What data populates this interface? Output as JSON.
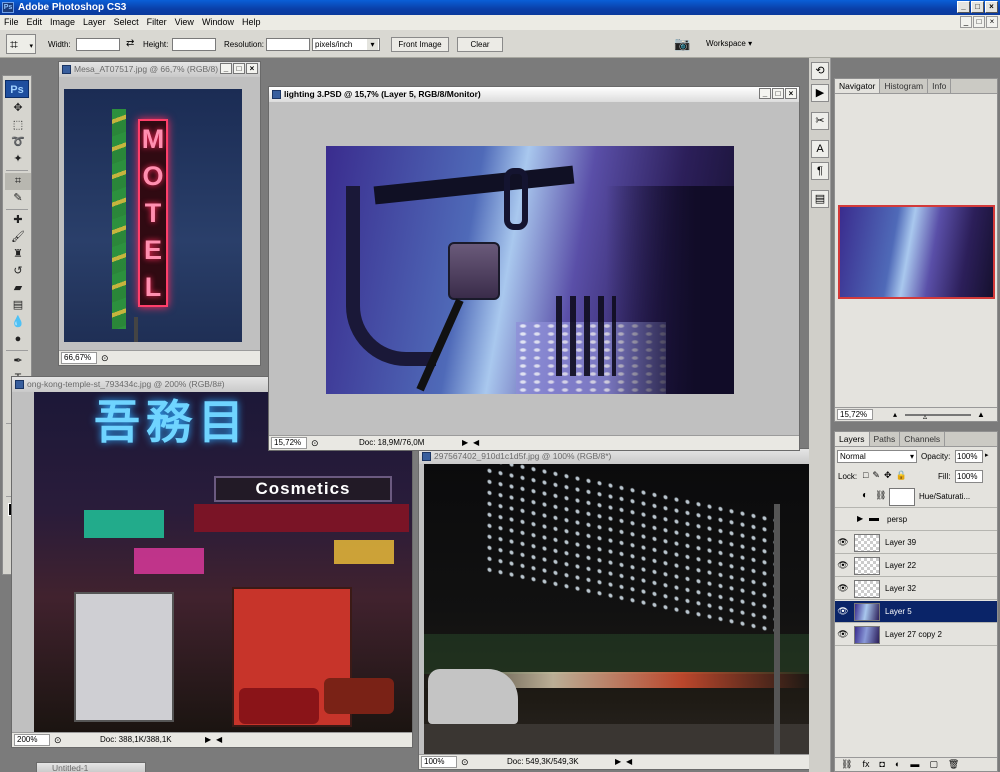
{
  "app": {
    "title": "Adobe Photoshop CS3",
    "logo": "Ps",
    "window_buttons": [
      "_",
      "□",
      "×"
    ]
  },
  "menu": {
    "items": [
      "File",
      "Edit",
      "Image",
      "Layer",
      "Select",
      "Filter",
      "View",
      "Window",
      "Help"
    ],
    "mdi_buttons": [
      "_",
      "□",
      "×"
    ]
  },
  "options": {
    "width_label": "Width:",
    "height_label": "Height:",
    "resolution_label": "Resolution:",
    "units_value": "pixels/inch",
    "front_image_label": "Front Image",
    "clear_label": "Clear",
    "workspace_label": "Workspace ▾"
  },
  "toolbox": {
    "icons": [
      "move-icon",
      "marquee-icon",
      "lasso-icon",
      "magic-wand-icon",
      "crop-icon",
      "slice-icon",
      "healing-brush-icon",
      "brush-icon",
      "clone-stamp-icon",
      "history-brush-icon",
      "eraser-icon",
      "gradient-icon",
      "blur-icon",
      "dodge-icon",
      "pen-icon",
      "type-icon",
      "path-selection-icon",
      "rectangle-icon",
      "notes-icon",
      "eyedropper-icon",
      "hand-icon",
      "zoom-icon"
    ]
  },
  "documents": {
    "mesa": {
      "title": "Mesa_AT07517.jpg @ 66,7% (RGB/8)",
      "zoom": "66,67%",
      "sign_text": "MOTEL"
    },
    "lighting": {
      "title": "lighting 3.PSD @ 15,7% (Layer 5, RGB/8/Monitor)",
      "zoom": "15,72%",
      "doc": "Doc: 18,9M/76,0M"
    },
    "hongkong": {
      "title": "ong-kong-temple-st_793434c.jpg @ 200% (RGB/8#)",
      "zoom": "200%",
      "doc": "Doc: 388,1K/388,1K",
      "sign_text": "Cosmetics"
    },
    "building": {
      "title": "297567402_910d1c1d5f.jpg @ 100% (RGB/8*)",
      "zoom": "100%",
      "doc": "Doc: 549,3K/549,3K"
    },
    "untitled": {
      "title": "Untitled-1"
    }
  },
  "navigator": {
    "tabs": [
      "Navigator",
      "Histogram",
      "Info"
    ],
    "zoom": "15,72%"
  },
  "layers": {
    "tabs": [
      "Layers",
      "Paths",
      "Channels"
    ],
    "blend_mode": "Normal",
    "opacity_label": "Opacity:",
    "opacity_value": "100%",
    "lock_label": "Lock:",
    "fill_label": "Fill:",
    "fill_value": "100%",
    "rows": [
      {
        "name": "Hue/Saturati...",
        "visible": false
      },
      {
        "name": "persp",
        "visible": false
      },
      {
        "name": "Layer 39",
        "visible": true
      },
      {
        "name": "Layer 22",
        "visible": true
      },
      {
        "name": "Layer 32",
        "visible": true
      },
      {
        "name": "Layer 5",
        "visible": true,
        "selected": true
      },
      {
        "name": "Layer 27 copy 2",
        "visible": true
      }
    ]
  },
  "colors": {
    "title_bar": "#0a4fc8",
    "selected_layer": "#0a2468",
    "workspace": "#7b7b7b"
  }
}
